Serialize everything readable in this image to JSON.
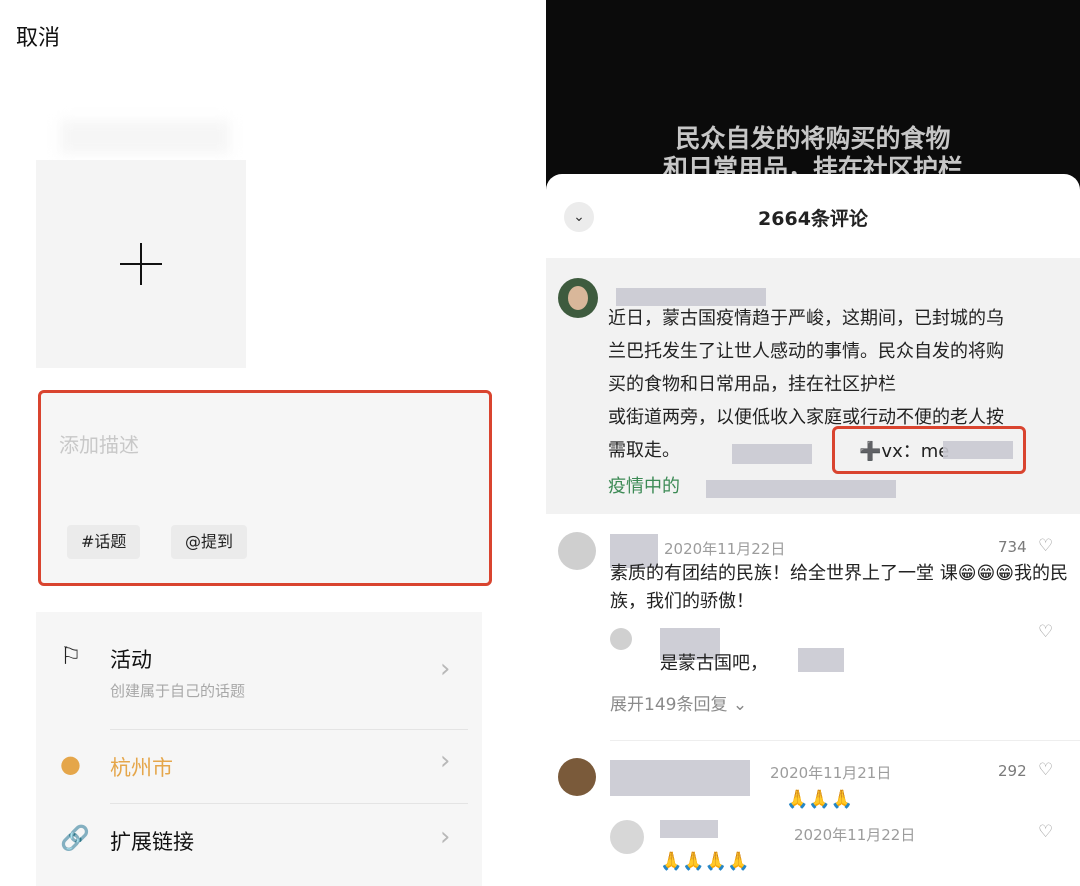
{
  "left": {
    "cancel_label": "取消",
    "description_placeholder": "添加描述",
    "chips": [
      "#话题",
      "@提到"
    ],
    "options": [
      {
        "icon": "flag-icon",
        "title": "活动",
        "subtitle": "创建属于自己的话题"
      },
      {
        "icon": "location-pin-icon",
        "title": "杭州市"
      },
      {
        "icon": "link-icon",
        "title": "扩展链接"
      }
    ],
    "colors": {
      "highlight_border": "#d9442f",
      "location_accent": "#e5a64a"
    }
  },
  "right": {
    "video_caption": [
      "民众自发的将购买的食物",
      "和日常用品，挂在社区护栏"
    ],
    "comment_count": "2664条评论",
    "pinned": {
      "text": "近日，蒙古国疫情趋于严峻，这期间，已封城的乌\n兰巴托发生了让世人感动的事情。民众自发的将购\n买的食物和日常用品，挂在社区护栏\n或街道两旁，以便低收入家庭或行动不便的老人按\n需取走。",
      "vx_text": "➕vx：me",
      "topic_link": "疫情中的"
    },
    "comments": [
      {
        "date": "2020年11月22日",
        "likes": "734",
        "text": "素质的有团结的民族！给全世界上了一堂\n课😁😁😁我的民族，我们的骄傲！"
      },
      {
        "reply_text": "是蒙古国吧，"
      },
      {
        "expand_label": "展开149条回复"
      },
      {
        "date": "2020年11月21日",
        "likes": "292",
        "text": "🙏🙏🙏"
      },
      {
        "date": "2020年11月22日",
        "text": "🙏🙏🙏🙏"
      }
    ]
  }
}
